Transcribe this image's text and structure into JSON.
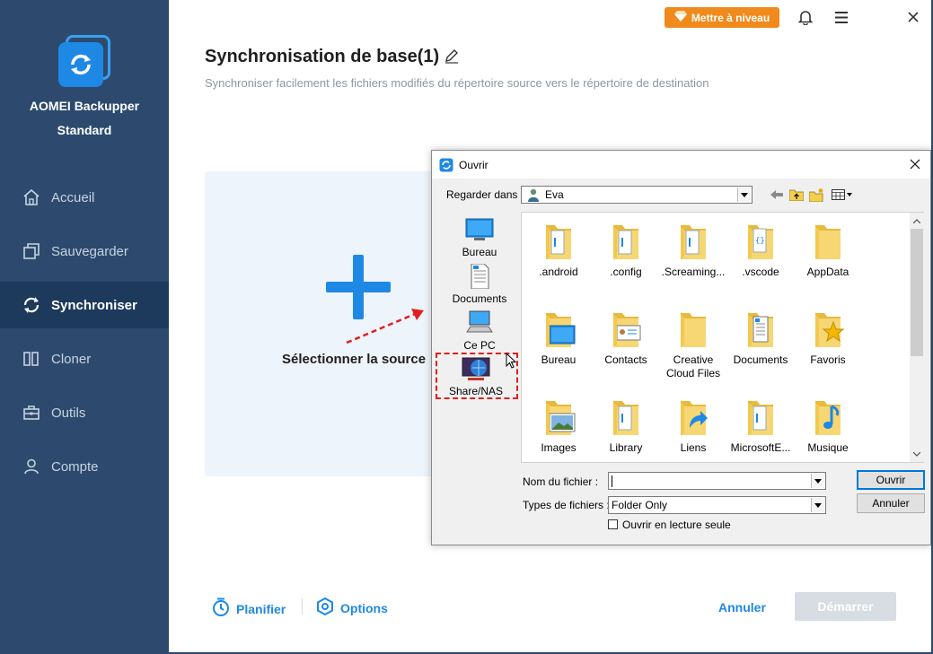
{
  "app": {
    "name": "AOMEI Backupper",
    "edition": "Standard",
    "upgrade_label": "Mettre à niveau"
  },
  "sidebar": {
    "items": [
      {
        "label": "Accueil",
        "icon": "home-icon"
      },
      {
        "label": "Sauvegarder",
        "icon": "backup-icon"
      },
      {
        "label": "Synchroniser",
        "icon": "sync-icon",
        "active": true
      },
      {
        "label": "Cloner",
        "icon": "clone-icon"
      },
      {
        "label": "Outils",
        "icon": "tools-icon"
      },
      {
        "label": "Compte",
        "icon": "account-icon"
      }
    ]
  },
  "main": {
    "title": "Synchronisation de base(1)",
    "subtitle": "Synchroniser facilement les fichiers modifiés du répertoire source vers le répertoire de destination",
    "source_label": "Sélectionner la source"
  },
  "bottom": {
    "schedule_label": "Planifier",
    "options_label": "Options",
    "cancel_label": "Annuler",
    "start_label": "Démarrer"
  },
  "dialog": {
    "title": "Ouvrir",
    "look_in_label": "Regarder dans :",
    "look_in_value": "Eva",
    "places": [
      {
        "label": "Bureau",
        "icon": "desktop-icon"
      },
      {
        "label": "Documents",
        "icon": "documents-icon"
      },
      {
        "label": "Ce PC",
        "icon": "computer-icon"
      },
      {
        "label": "Share/NAS",
        "icon": "network-share-icon"
      }
    ],
    "files": [
      {
        "label": ".android",
        "icon": "folder-doc-icon"
      },
      {
        "label": ".config",
        "icon": "folder-doc-icon"
      },
      {
        "label": ".Screaming...",
        "icon": "folder-doc-icon"
      },
      {
        "label": ".vscode",
        "icon": "folder-code-icon"
      },
      {
        "label": "AppData",
        "icon": "folder-icon"
      },
      {
        "label": "Bureau",
        "icon": "folder-desktop-icon"
      },
      {
        "label": "Contacts",
        "icon": "folder-contacts-icon"
      },
      {
        "label": "Creative Cloud Files",
        "icon": "folder-icon"
      },
      {
        "label": "Documents",
        "icon": "folder-documents-icon"
      },
      {
        "label": "Favoris",
        "icon": "folder-star-icon"
      },
      {
        "label": "Images",
        "icon": "folder-images-icon"
      },
      {
        "label": "Library",
        "icon": "folder-doc-icon"
      },
      {
        "label": "Liens",
        "icon": "folder-link-icon"
      },
      {
        "label": "MicrosoftE...",
        "icon": "folder-doc-icon"
      },
      {
        "label": "Musique",
        "icon": "folder-music-icon"
      }
    ],
    "filename_label": "Nom du fichier :",
    "filename_value": "",
    "filetype_label": "Types de fichiers :",
    "filetype_value": "Folder Only",
    "readonly_label": "Ouvrir en lecture seule",
    "open_button": "Ouvrir",
    "cancel_button": "Annuler"
  },
  "colors": {
    "sidebar_bg": "#2d4a6e",
    "sidebar_active": "#1d3a5c",
    "accent": "#1e88e5",
    "upgrade": "#f08a1c",
    "highlight": "#e02020",
    "folder": "#f7d774"
  }
}
